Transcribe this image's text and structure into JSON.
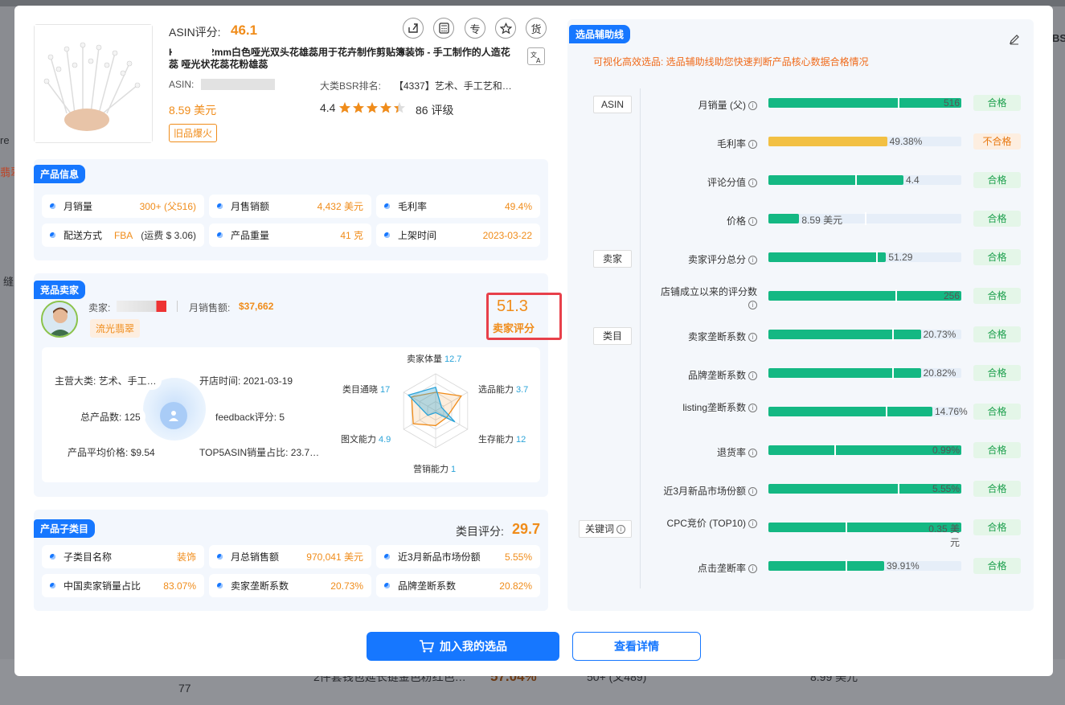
{
  "background": {
    "row_title": "2件套钱包延长链金色粉红色…",
    "row_pct": "57.04%",
    "row_sales": "50+ (父489)",
    "row_price": "8.99 美元",
    "row_num": "77",
    "side_text1": "re",
    "side_text2": "翡翠",
    "side_text3": "缝",
    "side_bs": "BS"
  },
  "product": {
    "asin_score_label": "ASIN评分:",
    "asin_score": "46.1",
    "title": "H          00Pcs 2mm白色哑光双头花雄蕊用于花卉制作剪贴簿装饰 - 手工制作的人造花蕊 哑光状花蕊花粉雄蕊",
    "asin_label": "ASIN:",
    "bsr_label": "大类BSR排名:",
    "bsr_value": "【4337】艺术、手工艺和…",
    "price": "8.59 美元",
    "rating": "4.4",
    "rating_count": "86 评级",
    "badge": "旧品爆火",
    "stars": 4.4
  },
  "toolbar": {
    "share": "share-icon",
    "calc": "calculator-icon",
    "zhuan": "专",
    "star": "star-icon",
    "huo": "货"
  },
  "product_info": {
    "tag": "产品信息",
    "items": [
      {
        "label": "月销量",
        "value": "300+ (父516)"
      },
      {
        "label": "月售销额",
        "value": "4,432 美元"
      },
      {
        "label": "毛利率",
        "value": "49.4%"
      },
      {
        "label": "配送方式",
        "value": "FBA",
        "extra": "(运费 $ 3.06)"
      },
      {
        "label": "产品重量",
        "value": "41 克"
      },
      {
        "label": "上架时间",
        "value": "2023-03-22"
      }
    ]
  },
  "seller": {
    "tag": "竞品卖家",
    "seller_label": "卖家:",
    "sales_label": "月销售额:",
    "sales_value": "$37,662",
    "shop_tag": "流光翡翠",
    "score": "51.3",
    "score_label": "卖家评分",
    "main_cat": "主营大类: 艺术、手工…",
    "open_time": "开店时间: 2021-03-19",
    "total_products": "总产品数: 125",
    "feedback": "feedback评分: 5",
    "avg_price": "产品平均价格: $9.54",
    "top5": "TOP5ASIN销量占比: 23.7…"
  },
  "radar": {
    "axes": [
      {
        "label": "卖家体量",
        "value": "12.7"
      },
      {
        "label": "选品能力",
        "value": "3.7"
      },
      {
        "label": "生存能力",
        "value": "12"
      },
      {
        "label": "营销能力",
        "value": "1"
      },
      {
        "label": "图文能力",
        "value": "4.9"
      },
      {
        "label": "类目通晓",
        "value": "17"
      }
    ]
  },
  "subcat": {
    "tag": "产品子类目",
    "score_label": "类目评分:",
    "score": "29.7",
    "items": [
      {
        "label": "子类目名称",
        "value": "装饰"
      },
      {
        "label": "月总销售额",
        "value": "970,041 美元"
      },
      {
        "label": "近3月新品市场份额",
        "value": "5.55%"
      },
      {
        "label": "中国卖家销量占比",
        "value": "83.07%"
      },
      {
        "label": "卖家垄断系数",
        "value": "20.73%"
      },
      {
        "label": "品牌垄断系数",
        "value": "20.82%"
      }
    ]
  },
  "guide": {
    "tag": "选品辅助线",
    "desc": "可视化高效选品: 选品辅助线助您快速判断产品核心数据合格情况",
    "groups": [
      "ASIN",
      "卖家",
      "类目",
      "关键词"
    ],
    "rows": [
      {
        "label": "月销量 (父)",
        "value": "516",
        "fill": 1.0,
        "mark": 0.67,
        "color": "#14b883",
        "status": "合格",
        "ok": true,
        "inside": true
      },
      {
        "label": "毛利率",
        "value": "49.38%",
        "fill": 0.615,
        "mark": 1.2,
        "color": "#f2c043",
        "status": "不合格",
        "ok": false,
        "inside": false
      },
      {
        "label": "评论分值",
        "value": "4.4",
        "fill": 0.7,
        "mark": 0.45,
        "color": "#14b883",
        "status": "合格",
        "ok": true,
        "inside": false
      },
      {
        "label": "价格",
        "value": "8.59 美元",
        "fill": 0.16,
        "mark": 0.5,
        "color": "#14b883",
        "status": "合格",
        "ok": true,
        "inside": false
      },
      {
        "label": "卖家评分总分",
        "value": "51.29",
        "fill": 0.61,
        "mark": 0.56,
        "color": "#14b883",
        "status": "合格",
        "ok": true,
        "inside": false
      },
      {
        "label": "店铺成立以来的评分数",
        "value": "256",
        "fill": 1.0,
        "mark": 0.66,
        "color": "#14b883",
        "status": "合格",
        "ok": true,
        "inside": true
      },
      {
        "label": "卖家垄断系数",
        "value": "20.73%",
        "fill": 0.79,
        "mark": 0.64,
        "color": "#14b883",
        "status": "合格",
        "ok": true,
        "inside": false
      },
      {
        "label": "品牌垄断系数",
        "value": "20.82%",
        "fill": 0.79,
        "mark": 0.64,
        "color": "#14b883",
        "status": "合格",
        "ok": true,
        "inside": false
      },
      {
        "label": "listing垄断系数",
        "value": "14.76%",
        "fill": 0.85,
        "mark": 0.61,
        "color": "#14b883",
        "status": "合格",
        "ok": true,
        "inside": false
      },
      {
        "label": "退货率",
        "value": "0.99%",
        "fill": 1.0,
        "mark": 0.34,
        "color": "#14b883",
        "status": "合格",
        "ok": true,
        "inside": true
      },
      {
        "label": "近3月新品市场份额",
        "value": "5.55%",
        "fill": 1.0,
        "mark": 0.67,
        "color": "#14b883",
        "status": "合格",
        "ok": true,
        "inside": true
      },
      {
        "label": "CPC竞价 (TOP10)",
        "value": "0.35 美元",
        "fill": 1.0,
        "mark": 0.4,
        "color": "#14b883",
        "status": "合格",
        "ok": true,
        "inside": true
      },
      {
        "label": "点击垄断率",
        "value": "39.91%",
        "fill": 0.6,
        "mark": 0.4,
        "color": "#14b883",
        "status": "合格",
        "ok": true,
        "inside": false
      }
    ]
  },
  "buttons": {
    "add": "加入我的选品",
    "detail": "查看详情"
  }
}
